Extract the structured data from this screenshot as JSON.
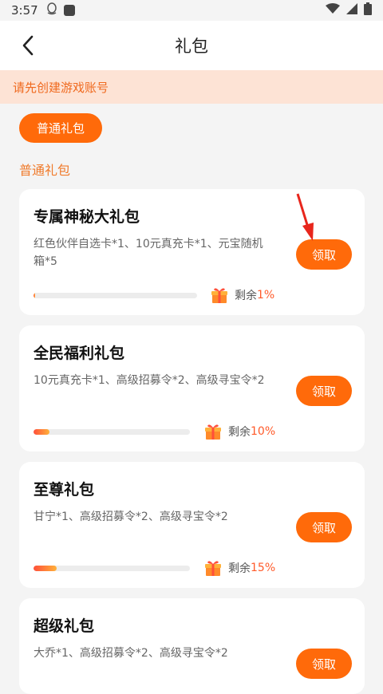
{
  "status": {
    "time": "3:57"
  },
  "header": {
    "title": "礼包"
  },
  "notice": {
    "text": "请先创建游戏账号"
  },
  "tabs": [
    {
      "label": "普通礼包"
    }
  ],
  "section": {
    "label": "普通礼包"
  },
  "remain_label": "剩余",
  "claim_label": "领取",
  "packs": [
    {
      "name": "专属神秘大礼包",
      "desc": "红色伙伴自选卡*1、10元真充卡*1、元宝随机箱*5",
      "remain_pct": 1,
      "remain_text": "1%"
    },
    {
      "name": "全民福利礼包",
      "desc": "10元真充卡*1、高级招募令*2、高级寻宝令*2",
      "remain_pct": 10,
      "remain_text": "10%"
    },
    {
      "name": "至尊礼包",
      "desc": "甘宁*1、高级招募令*2、高级寻宝令*2",
      "remain_pct": 15,
      "remain_text": "15%"
    },
    {
      "name": "超级礼包",
      "desc": "大乔*1、高级招募令*2、高级寻宝令*2",
      "remain_pct": null,
      "remain_text": ""
    }
  ],
  "colors": {
    "accent": "#ff6a0a",
    "notice_bg": "#fde3d5",
    "notice_text": "#f06a1f"
  }
}
